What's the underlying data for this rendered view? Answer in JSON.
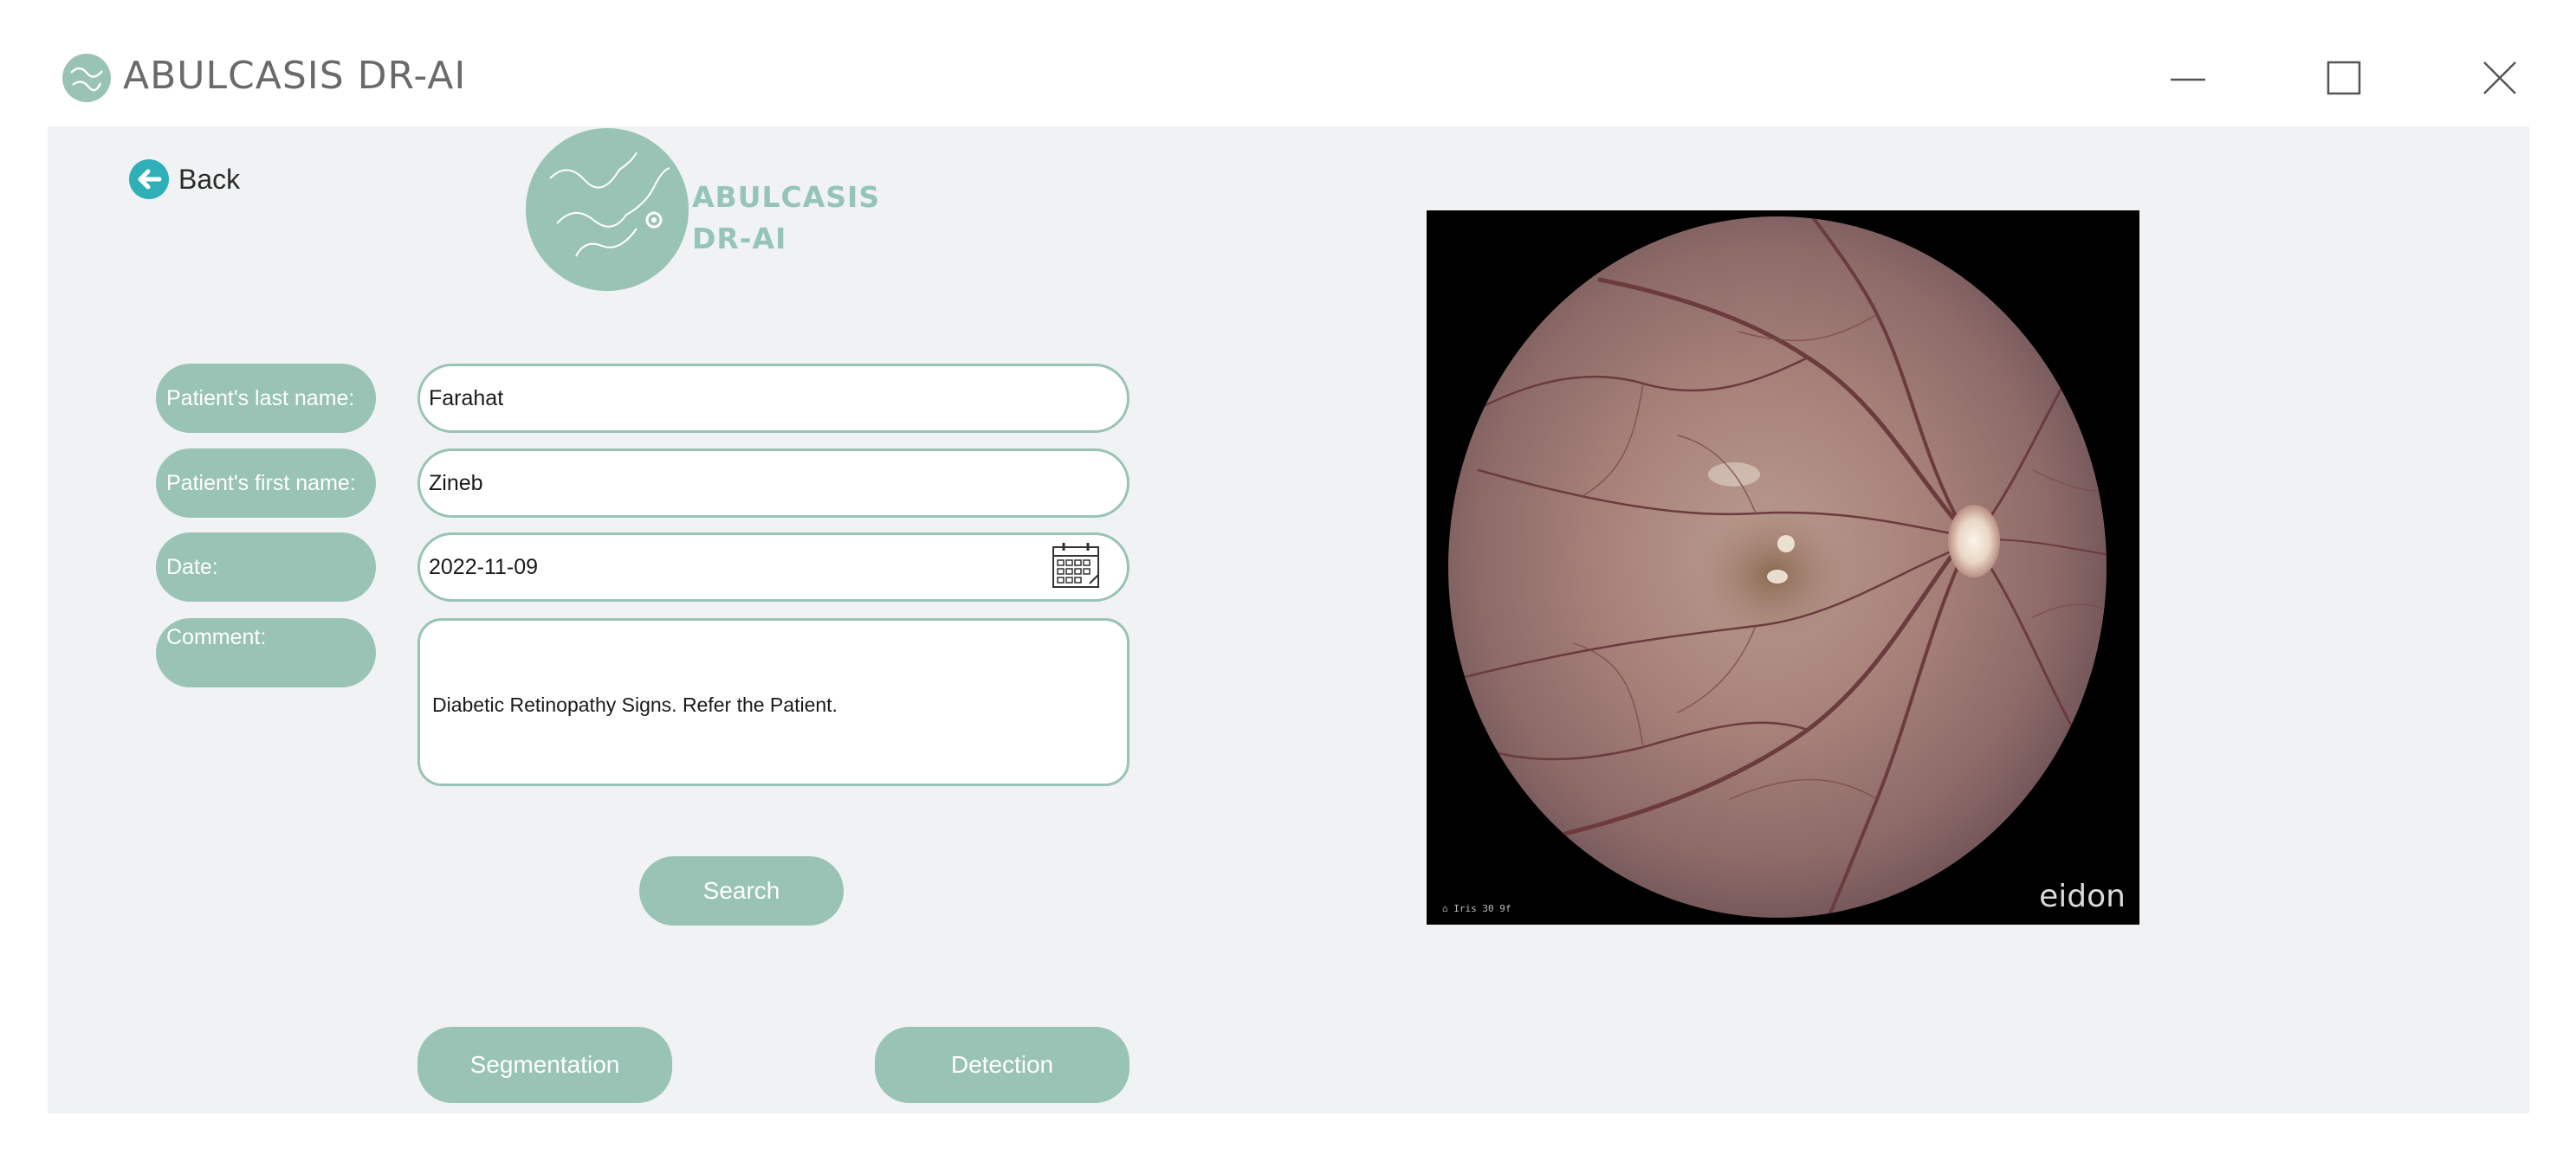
{
  "window": {
    "title": "ABULCASIS DR-AI"
  },
  "nav": {
    "back_label": "Back"
  },
  "logo": {
    "line1": "ABULCASIS",
    "line2": "DR-AI"
  },
  "form": {
    "last_name": {
      "label": "Patient's last name:",
      "value": "Farahat"
    },
    "first_name": {
      "label": "Patient's first name:",
      "value": "Zineb"
    },
    "date": {
      "label": "Date:",
      "value": "2022-11-09"
    },
    "comment": {
      "label": "Comment:",
      "value": "Diabetic Retinopathy Signs. Refer the Patient."
    }
  },
  "buttons": {
    "search": "Search",
    "segmentation": "Segmentation",
    "detection": "Detection"
  },
  "image": {
    "brand": "eidon",
    "corner_note": "⌂ Iris 30 9f"
  },
  "colors": {
    "accent": "#98c3b5",
    "background": "#f0f2f3",
    "back_icon": "#2fb0b8"
  },
  "icons": {
    "app": "app-logo-icon",
    "back": "back-arrow-icon",
    "calendar": "calendar-icon",
    "minimize": "minimize-icon",
    "maximize": "maximize-icon",
    "close": "close-icon"
  }
}
